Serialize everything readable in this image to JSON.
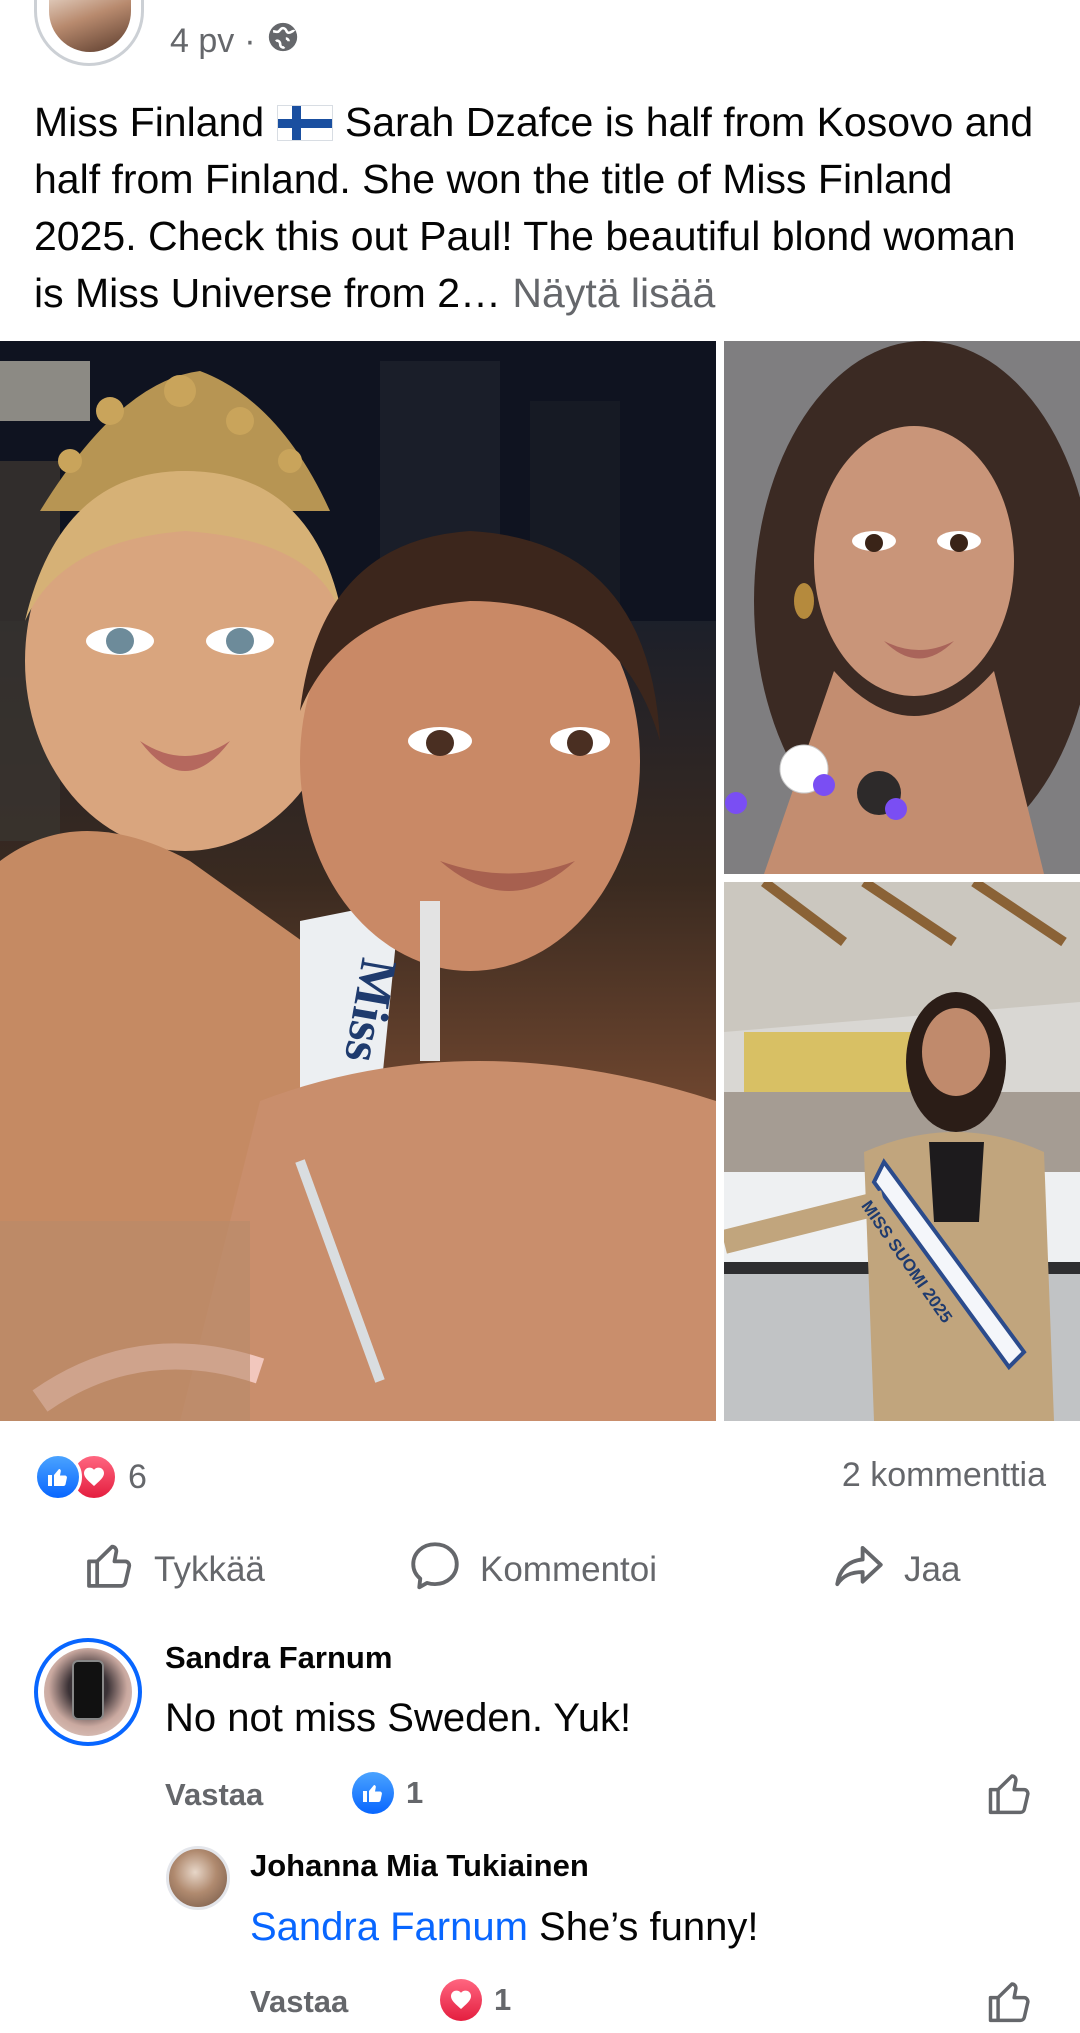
{
  "post": {
    "time": "4 pv",
    "separator": "·",
    "audience_icon": "globe-icon",
    "text_before_flag": "Miss Finland ",
    "text_after_flag": " Sarah Dzafce is half from Kosovo and half from Finland. She won the title of Miss Finland 2025. Check this out Paul! The beautiful blond woman is Miss Universe from 2…",
    "see_more": "Näytä lisää",
    "sash_text_main": "Miss",
    "sash_text_side": "MISS SUOMI 2025"
  },
  "reactions": {
    "count": "6",
    "icons": [
      "like-icon",
      "love-icon"
    ],
    "comments_count": "2 kommenttia"
  },
  "actions": {
    "like": "Tykkää",
    "comment": "Kommentoi",
    "share": "Jaa"
  },
  "comments": [
    {
      "author": "Sandra Farnum",
      "text": "No not miss Sweden. Yuk!",
      "reply_label": "Vastaa",
      "reaction_count": "1",
      "reaction_icon": "like-icon"
    }
  ],
  "replies": [
    {
      "author": "Johanna Mia Tukiainen",
      "mention": "Sandra Farnum",
      "text": " She’s funny!",
      "reply_label": "Vastaa",
      "reaction_count": "1",
      "reaction_icon": "love-icon"
    }
  ],
  "colors": {
    "accent": "#0866ff",
    "love": "#e41e3f",
    "secondary_text": "#65676b",
    "primary_text": "#050505"
  }
}
